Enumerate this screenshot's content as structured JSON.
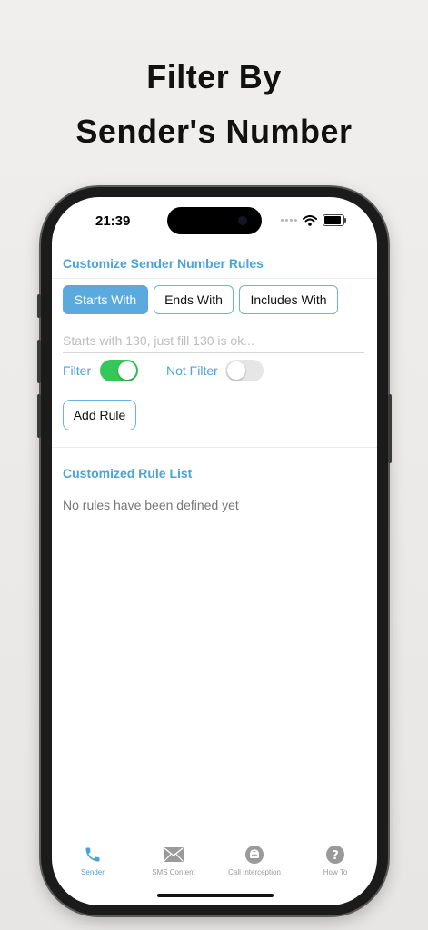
{
  "headline": {
    "line1": "Filter By",
    "line2": "Sender's Number"
  },
  "status_bar": {
    "time": "21:39"
  },
  "screen": {
    "section_title": "Customize Sender Number Rules",
    "segments": [
      {
        "label": "Starts With",
        "selected": true
      },
      {
        "label": "Ends With",
        "selected": false
      },
      {
        "label": "Includes With",
        "selected": false
      }
    ],
    "input": {
      "placeholder": "Starts with 130, just fill 130 is ok...",
      "value": ""
    },
    "filter_label": "Filter",
    "filter_on": true,
    "not_filter_label": "Not Filter",
    "not_filter_on": false,
    "add_rule_label": "Add Rule",
    "list_title": "Customized Rule List",
    "empty_message": "No rules have been defined yet"
  },
  "tabbar": {
    "items": [
      {
        "label": "Sender",
        "icon": "phone-icon",
        "active": true
      },
      {
        "label": "SMS Content",
        "icon": "envelope-icon",
        "active": false
      },
      {
        "label": "Call Interception",
        "icon": "call-block-icon",
        "active": false
      },
      {
        "label": "How To",
        "icon": "question-icon",
        "active": false
      }
    ]
  },
  "colors": {
    "accent": "#4aa3d9",
    "selected_segment": "#5aaadd",
    "toggle_on": "#34c759",
    "background": "#f1efed"
  }
}
